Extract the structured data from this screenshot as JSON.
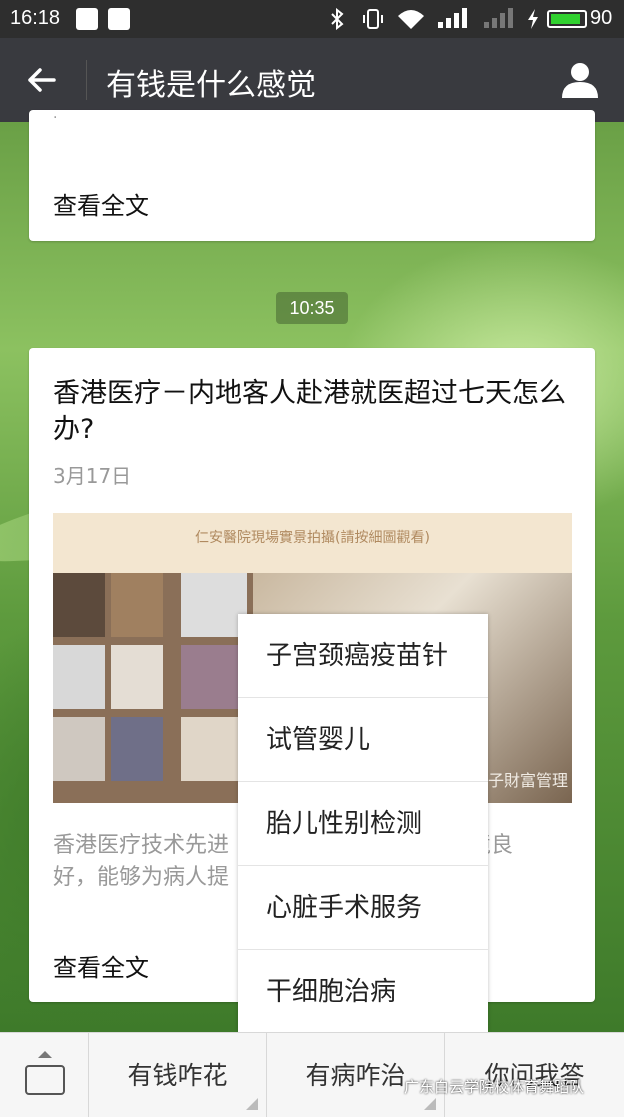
{
  "status_bar": {
    "time": "16:18",
    "battery": "90",
    "battery_level": 0.9,
    "icons": [
      "notification-icon",
      "upload-icon",
      "bluetooth-icon",
      "vibrate-icon",
      "wifi-icon",
      "signal-4g-icon",
      "signal-icon",
      "charging-icon",
      "battery-icon"
    ]
  },
  "title_bar": {
    "title": "有钱是什么感觉",
    "back_icon": "arrow-left-icon",
    "profile_icon": "person-icon"
  },
  "messages": {
    "prev_card": {
      "read_more": "查看全文"
    },
    "timestamp": "10:35",
    "article": {
      "title": "香港医疗－内地客人赴港就医超过七天怎么办?",
      "date": "3月17日",
      "image_caption": "仁安醫院現場實景拍攝(請按細圖觀看)",
      "image_watermark": "子財富管理",
      "summary": "香港医疗技术先进，医院环境良好，能够为病人提供优质服务。",
      "summary_visible_left": "香港医疗技术先进",
      "summary_visible_right": "境良",
      "summary_line2_left": "好，能够为病人提",
      "summary_line2_right": "。",
      "read_more": "查看全文"
    }
  },
  "popup_menu": {
    "items": [
      "子宫颈癌疫苗针",
      "试管婴儿",
      "胎儿性别检测",
      "心脏手术服务",
      "干细胞治病"
    ]
  },
  "bottom_menu": {
    "keyboard_icon": "keyboard-icon",
    "tabs": [
      "有钱咋花",
      "有病咋治",
      "你问我答"
    ]
  },
  "watermark": "广东白云学院校体育舞蹈队",
  "colors": {
    "title_bar": "#393a3f",
    "status_bar": "#2e2e2e",
    "battery": "#31d12f",
    "background_green": "#6aa046"
  }
}
